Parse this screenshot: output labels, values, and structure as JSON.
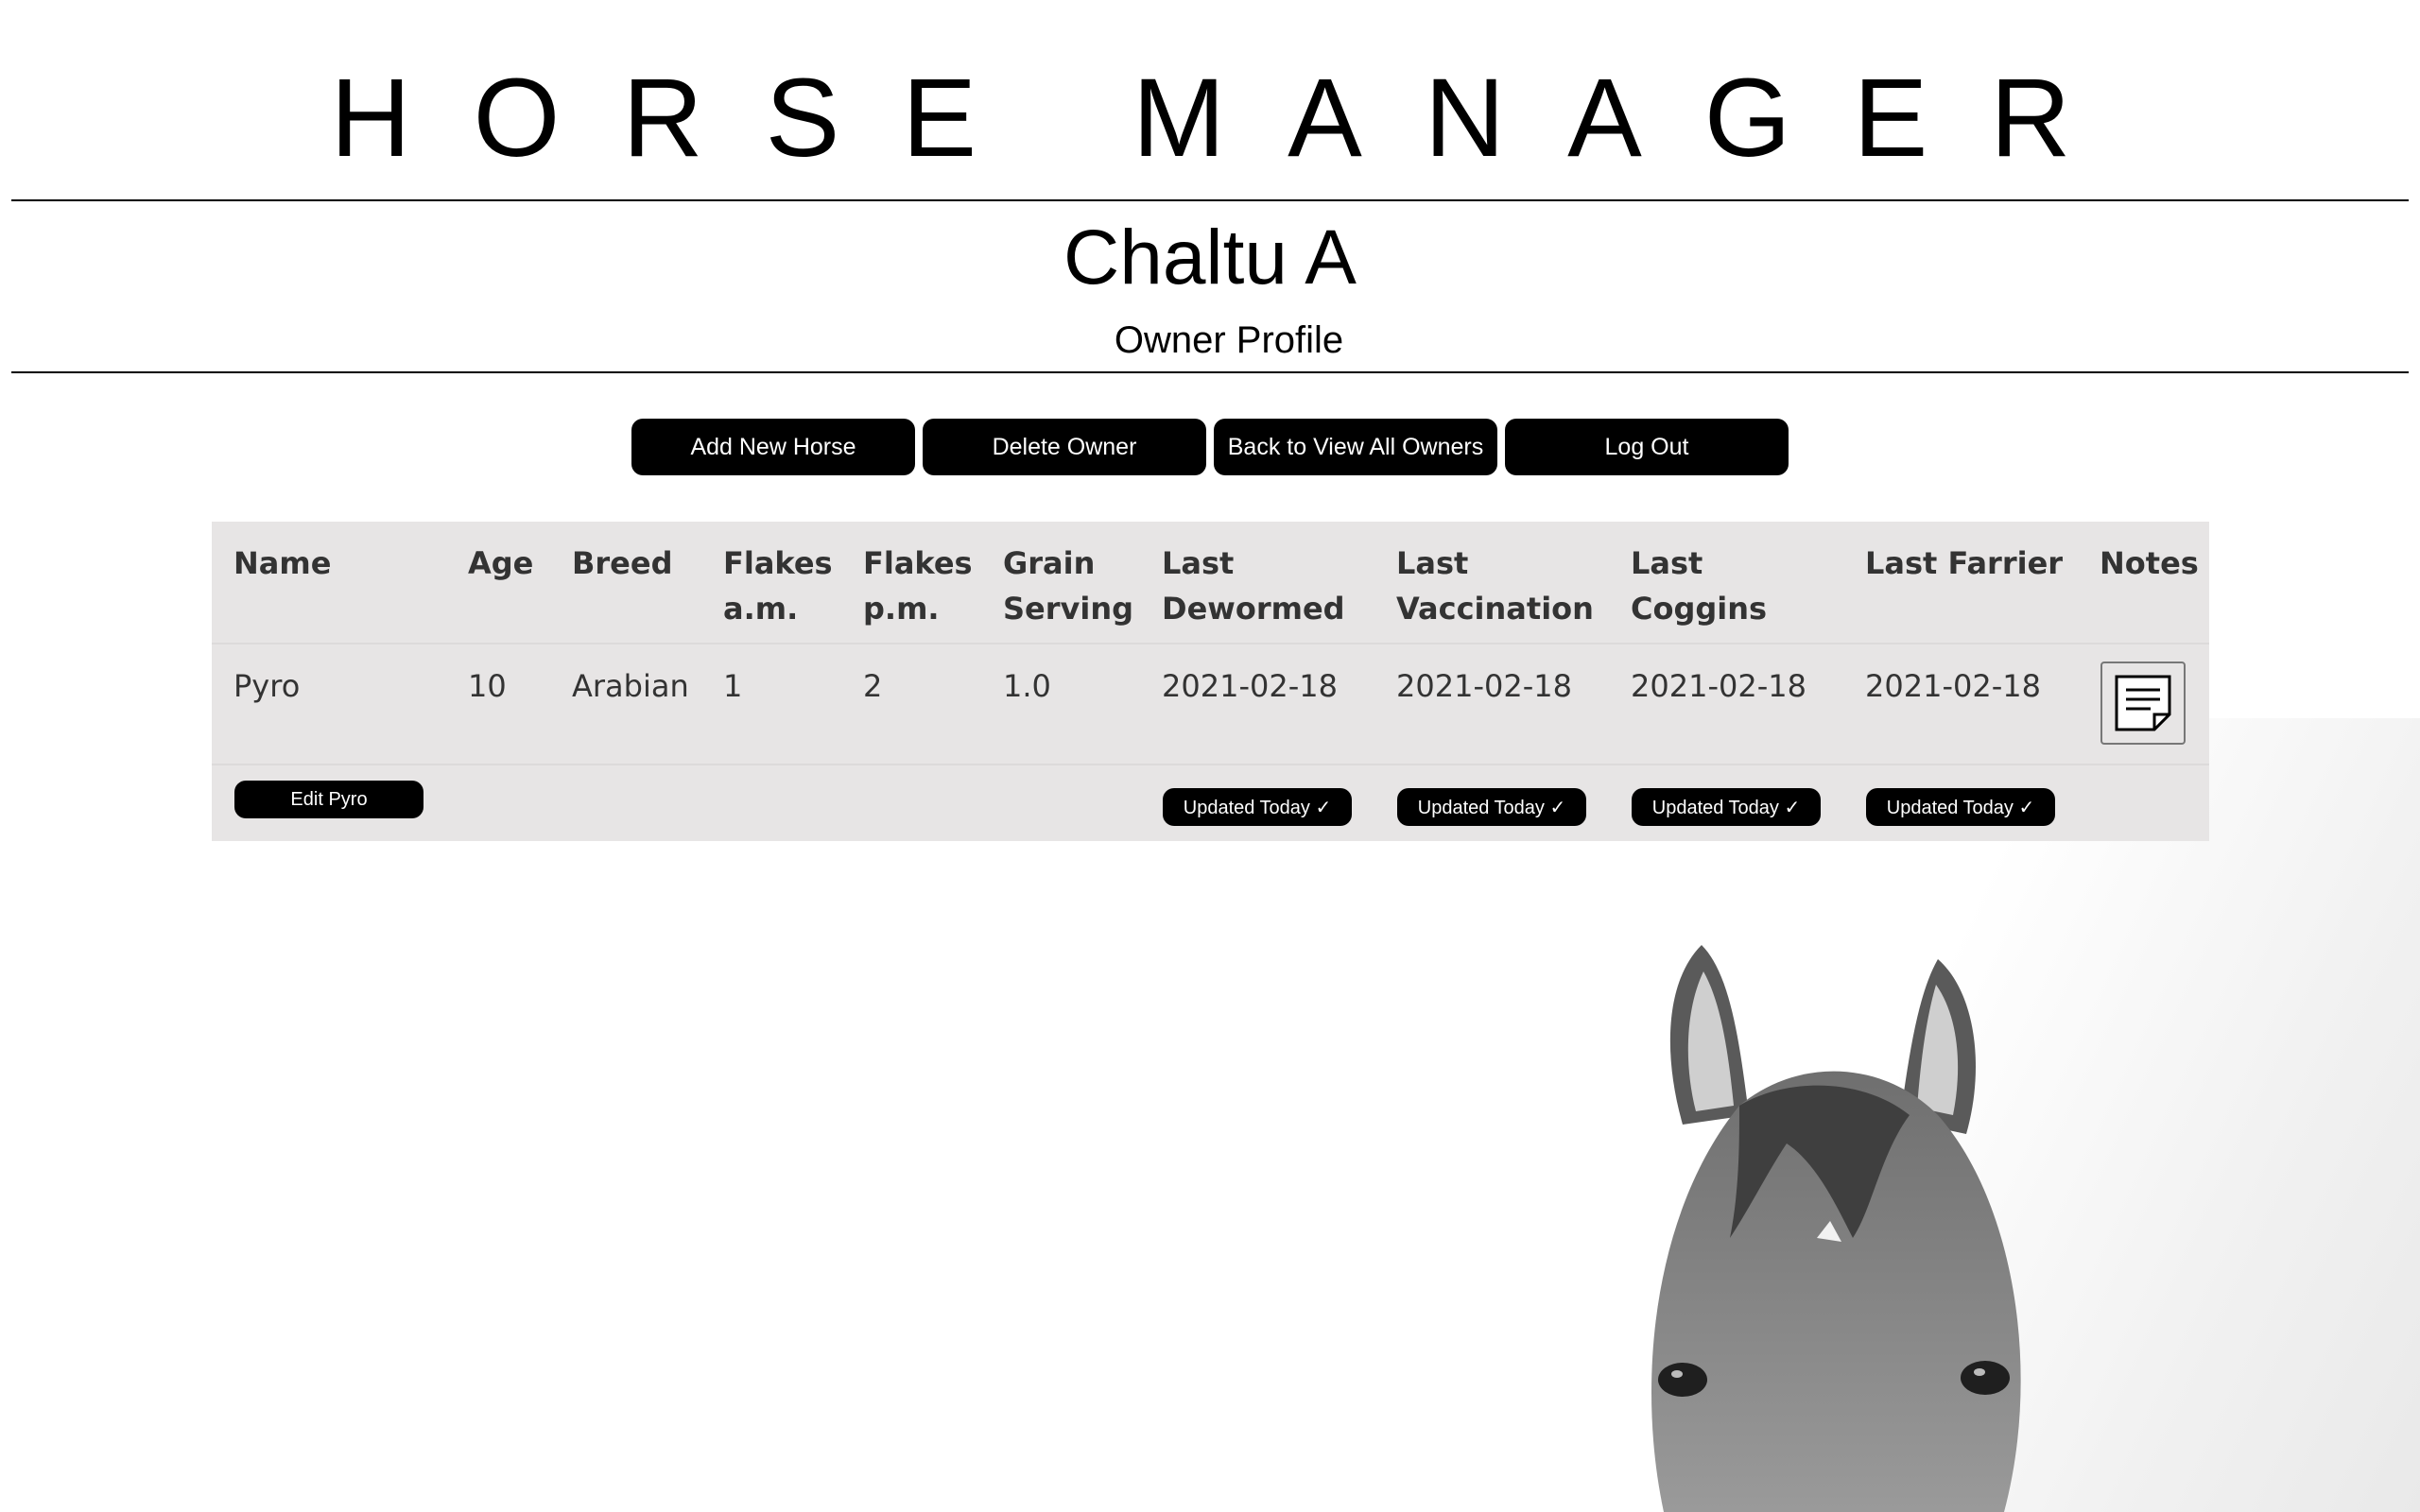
{
  "app_title": "HORSE MANAGER",
  "owner": {
    "name": "Chaltu A",
    "subtitle": "Owner Profile"
  },
  "actions": {
    "add_horse": "Add New Horse",
    "delete_owner": "Delete Owner",
    "back": "Back to View All Owners",
    "logout": "Log Out"
  },
  "table": {
    "headers": {
      "name": "Name",
      "age": "Age",
      "breed": "Breed",
      "flakes_am": [
        "Flakes",
        "a.m."
      ],
      "flakes_pm": [
        "Flakes",
        "p.m."
      ],
      "grain": [
        "Grain",
        "Serving"
      ],
      "dewormed": [
        "Last",
        "Dewormed"
      ],
      "vaccination": [
        "Last",
        "Vaccination"
      ],
      "coggins": [
        "Last",
        "Coggins"
      ],
      "farrier": "Last Farrier",
      "notes": "Notes"
    },
    "rows": [
      {
        "name": "Pyro",
        "age": "10",
        "breed": "Arabian",
        "flakes_am": "1",
        "flakes_pm": "2",
        "grain": "1.0",
        "dewormed": "2021-02-18",
        "vaccination": "2021-02-18",
        "coggins": "2021-02-18",
        "farrier": "2021-02-18",
        "edit_label": "Edit Pyro",
        "update_label": "Updated Today ✓"
      }
    ]
  },
  "colors": {
    "button_bg": "#000000",
    "table_bg": "#e7e5e5",
    "text": "#333333"
  },
  "icons": {
    "notes": "notes-document-icon"
  }
}
